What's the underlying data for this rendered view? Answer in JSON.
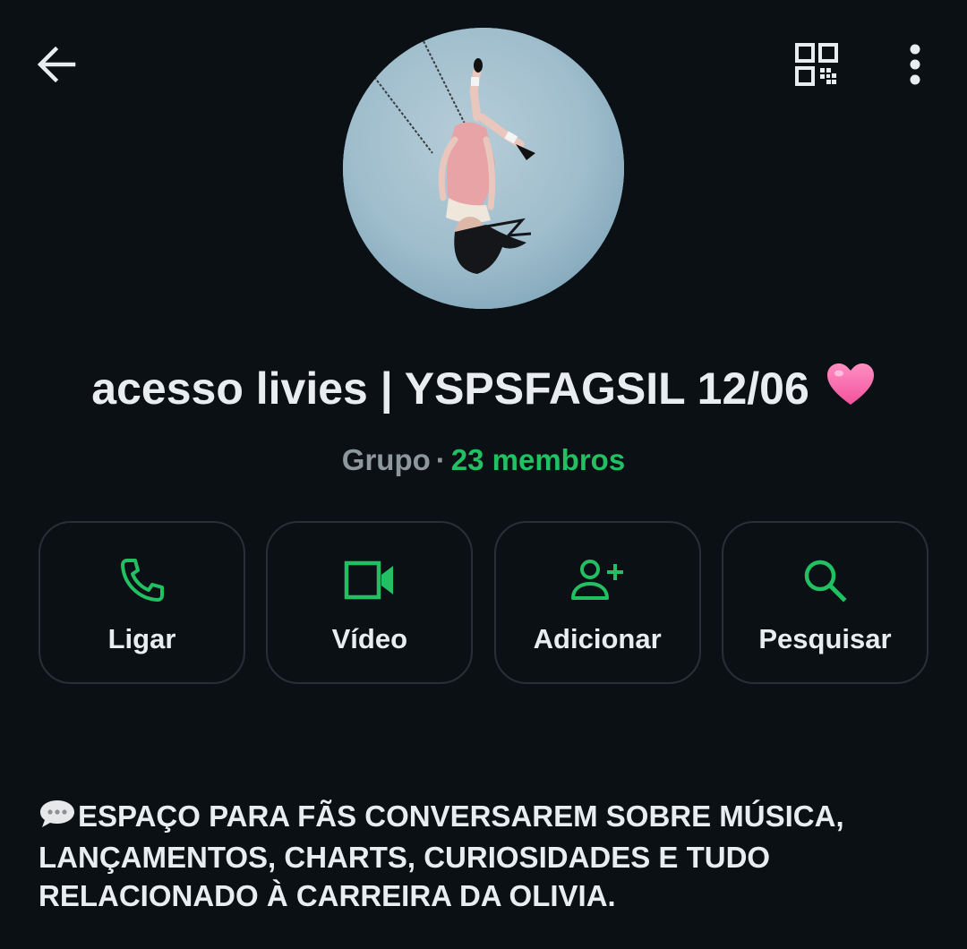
{
  "header": {
    "back_icon": "arrow-left-icon",
    "qr_icon": "qr-code-icon",
    "menu_icon": "more-vertical-icon"
  },
  "profile": {
    "name": "acesso livies | YSPSFAGSIL 12/06",
    "name_emoji": "pink-heart-icon",
    "type": "Grupo",
    "separator": "·",
    "members": "23 membros"
  },
  "actions": [
    {
      "label": "Ligar",
      "icon": "phone-icon"
    },
    {
      "label": "Vídeo",
      "icon": "video-camera-icon"
    },
    {
      "label": "Adicionar",
      "icon": "add-person-icon"
    },
    {
      "label": "Pesquisar",
      "icon": "search-icon"
    }
  ],
  "description": {
    "emoji": "speech-bubble-icon",
    "lines": [
      "ESPAÇO PARA FÃS CONVERSAREM SOBRE MÚSICA,",
      "LANÇAMENTOS, CHARTS, CURIOSIDADES E TUDO",
      "RELACIONADO À CARREIRA DA OLIVIA."
    ]
  },
  "colors": {
    "background": "#0b1014",
    "accent": "#21c063",
    "text": "#e9edef",
    "muted": "#8d979c",
    "card_border": "#283035"
  }
}
